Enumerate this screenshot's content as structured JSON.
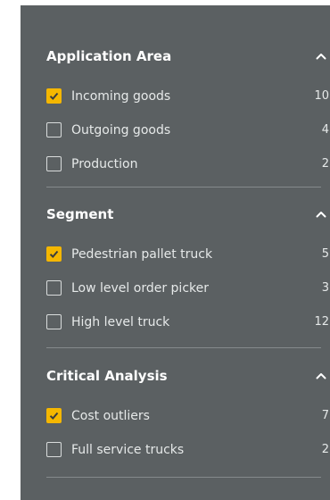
{
  "colors": {
    "panel_bg": "#5b6062",
    "accent": "#f5b700",
    "divider": "#858a8c"
  },
  "filters": {
    "sections": [
      {
        "title": "Application Area",
        "expanded": true,
        "options": [
          {
            "label": "Incoming goods",
            "count": "10",
            "checked": true
          },
          {
            "label": "Outgoing goods",
            "count": "4",
            "checked": false
          },
          {
            "label": "Production",
            "count": "2",
            "checked": false
          }
        ]
      },
      {
        "title": "Segment",
        "expanded": true,
        "options": [
          {
            "label": "Pedestrian pallet truck",
            "count": "5",
            "checked": true
          },
          {
            "label": "Low level order picker",
            "count": "3",
            "checked": false
          },
          {
            "label": "High level truck",
            "count": "12",
            "checked": false
          }
        ]
      },
      {
        "title": "Critical Analysis",
        "expanded": true,
        "options": [
          {
            "label": "Cost outliers",
            "count": "7",
            "checked": true
          },
          {
            "label": "Full service trucks",
            "count": "2",
            "checked": false
          }
        ]
      }
    ]
  },
  "icons": {
    "chevron": "chevron-up-icon",
    "check": "checkmark-icon"
  }
}
